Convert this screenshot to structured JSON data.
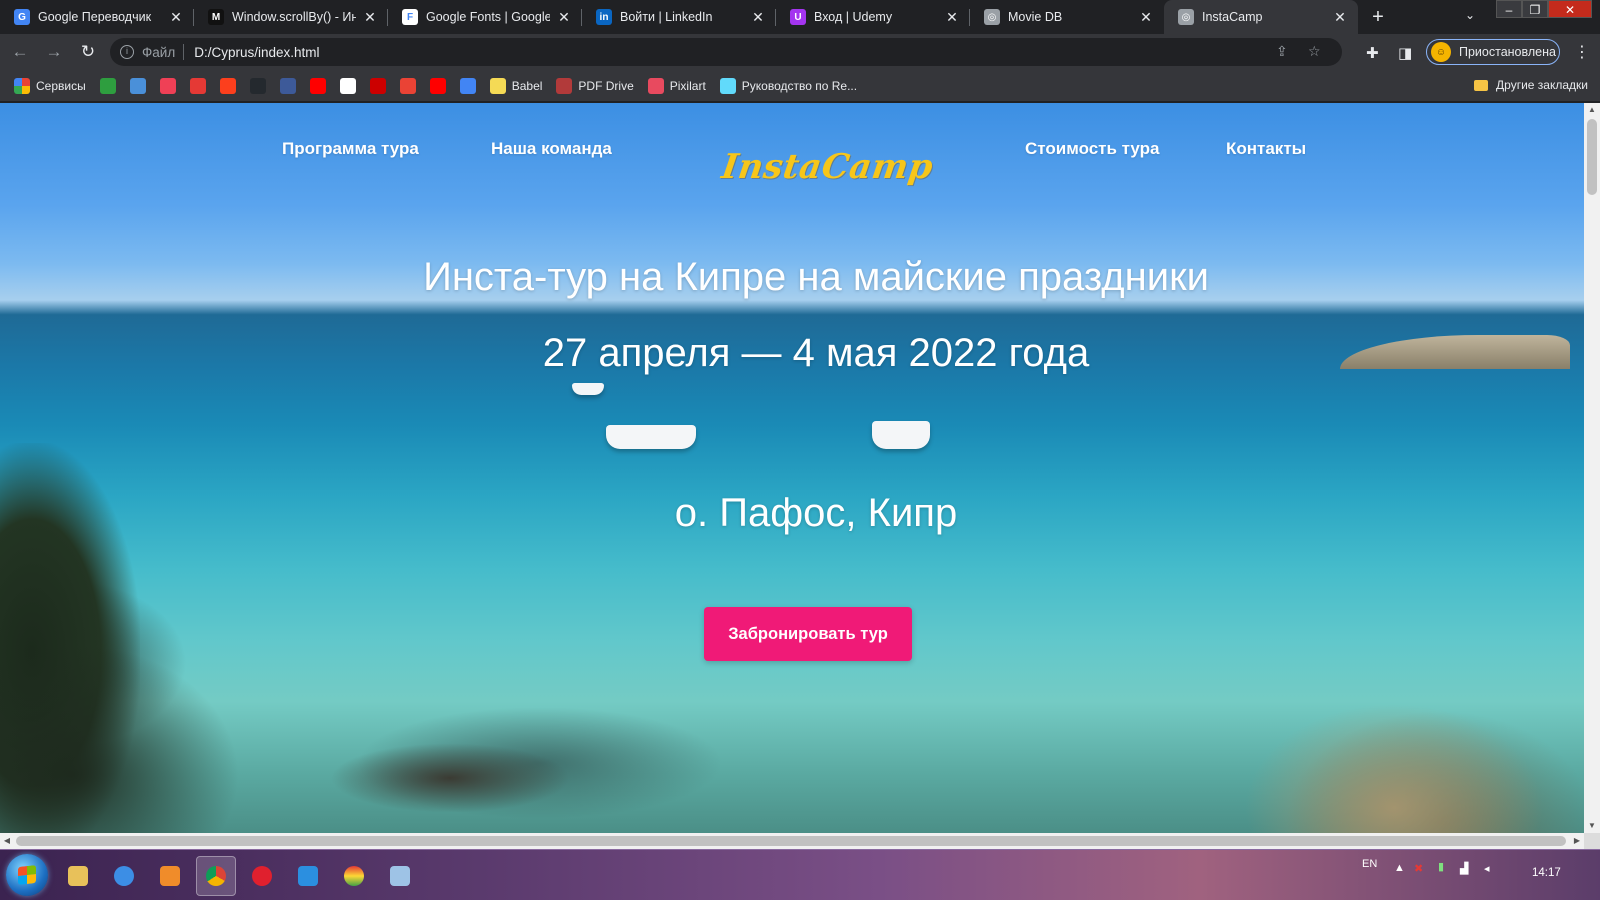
{
  "browser": {
    "tabs": [
      {
        "title": "Google Переводчик",
        "icon": "google-translate-icon",
        "color": "#4285f4",
        "glyph": "G"
      },
      {
        "title": "Window.scrollBy() - Инте",
        "icon": "mdn-icon",
        "color": "#111111",
        "glyph": "M"
      },
      {
        "title": "Google Fonts | Google",
        "icon": "google-fonts-icon",
        "color": "#ffffff",
        "glyph": "F"
      },
      {
        "title": "Войти | LinkedIn",
        "icon": "linkedin-icon",
        "color": "#0a66c2",
        "glyph": "in"
      },
      {
        "title": "Вход | Udemy",
        "icon": "udemy-icon",
        "color": "#a435f0",
        "glyph": "U"
      },
      {
        "title": "Movie DB",
        "icon": "globe-icon",
        "color": "#9aa0a6",
        "glyph": "◎"
      },
      {
        "title": "InstaCamp",
        "icon": "globe-icon",
        "color": "#9aa0a6",
        "glyph": "◎",
        "active": true
      }
    ],
    "new_tab": "+",
    "address": {
      "scheme": "Файл",
      "url": "D:/Cyprus/index.html"
    },
    "profile_label": "Приостановлена",
    "bookmarks": [
      {
        "label": "Сервисы",
        "icon": "apps-grid-icon",
        "color": "#e8453c"
      },
      {
        "label": "",
        "icon": "feed-icon",
        "color": "#2e9e3f"
      },
      {
        "label": "",
        "icon": "bookmark-4-icon",
        "color": "#4a90d9"
      },
      {
        "label": "",
        "icon": "pocket-icon",
        "color": "#ef4056"
      },
      {
        "label": "",
        "icon": "bookmark-red-icon",
        "color": "#e53935"
      },
      {
        "label": "",
        "icon": "yandex-icon",
        "color": "#fc3f1d"
      },
      {
        "label": "",
        "icon": "github-icon",
        "color": "#24292e"
      },
      {
        "label": "",
        "icon": "graduation-cap-icon",
        "color": "#3d5a99"
      },
      {
        "label": "",
        "icon": "youtube-icon",
        "color": "#ff0000"
      },
      {
        "label": "",
        "icon": "google-icon",
        "color": "#ffffff"
      },
      {
        "label": "",
        "icon": "yandex-y-icon",
        "color": "#cc0000"
      },
      {
        "label": "",
        "icon": "gmail-icon",
        "color": "#ea4335"
      },
      {
        "label": "",
        "icon": "youtube-icon",
        "color": "#ff0000"
      },
      {
        "label": "",
        "icon": "google-translate-icon",
        "color": "#4285f4"
      },
      {
        "label": "Babel",
        "icon": "babel-icon",
        "color": "#f5da55"
      },
      {
        "label": "PDF Drive",
        "icon": "pdf-drive-icon",
        "color": "#b23a3a"
      },
      {
        "label": "Pixilart",
        "icon": "heart-icon",
        "color": "#e84a5f"
      },
      {
        "label": "Руководство по Re...",
        "icon": "react-icon",
        "color": "#61dafb"
      }
    ],
    "other_bookmarks": "Другие закладки"
  },
  "site": {
    "nav": {
      "program": "Программа тура",
      "team": "Наша команда",
      "logo": "InstaCamp",
      "price": "Стоимость тура",
      "contacts": "Контакты"
    },
    "hero": {
      "title": "Инста-тур на Кипре на майские праздники",
      "dates": "27 апреля — 4 мая 2022 года",
      "place": "о. Пафос, Кипр",
      "cta": "Забронировать тур"
    },
    "colors": {
      "accent": "#f01a77",
      "logo": "#f7c61a"
    }
  },
  "taskbar": {
    "language": "EN",
    "time": "14:17"
  }
}
